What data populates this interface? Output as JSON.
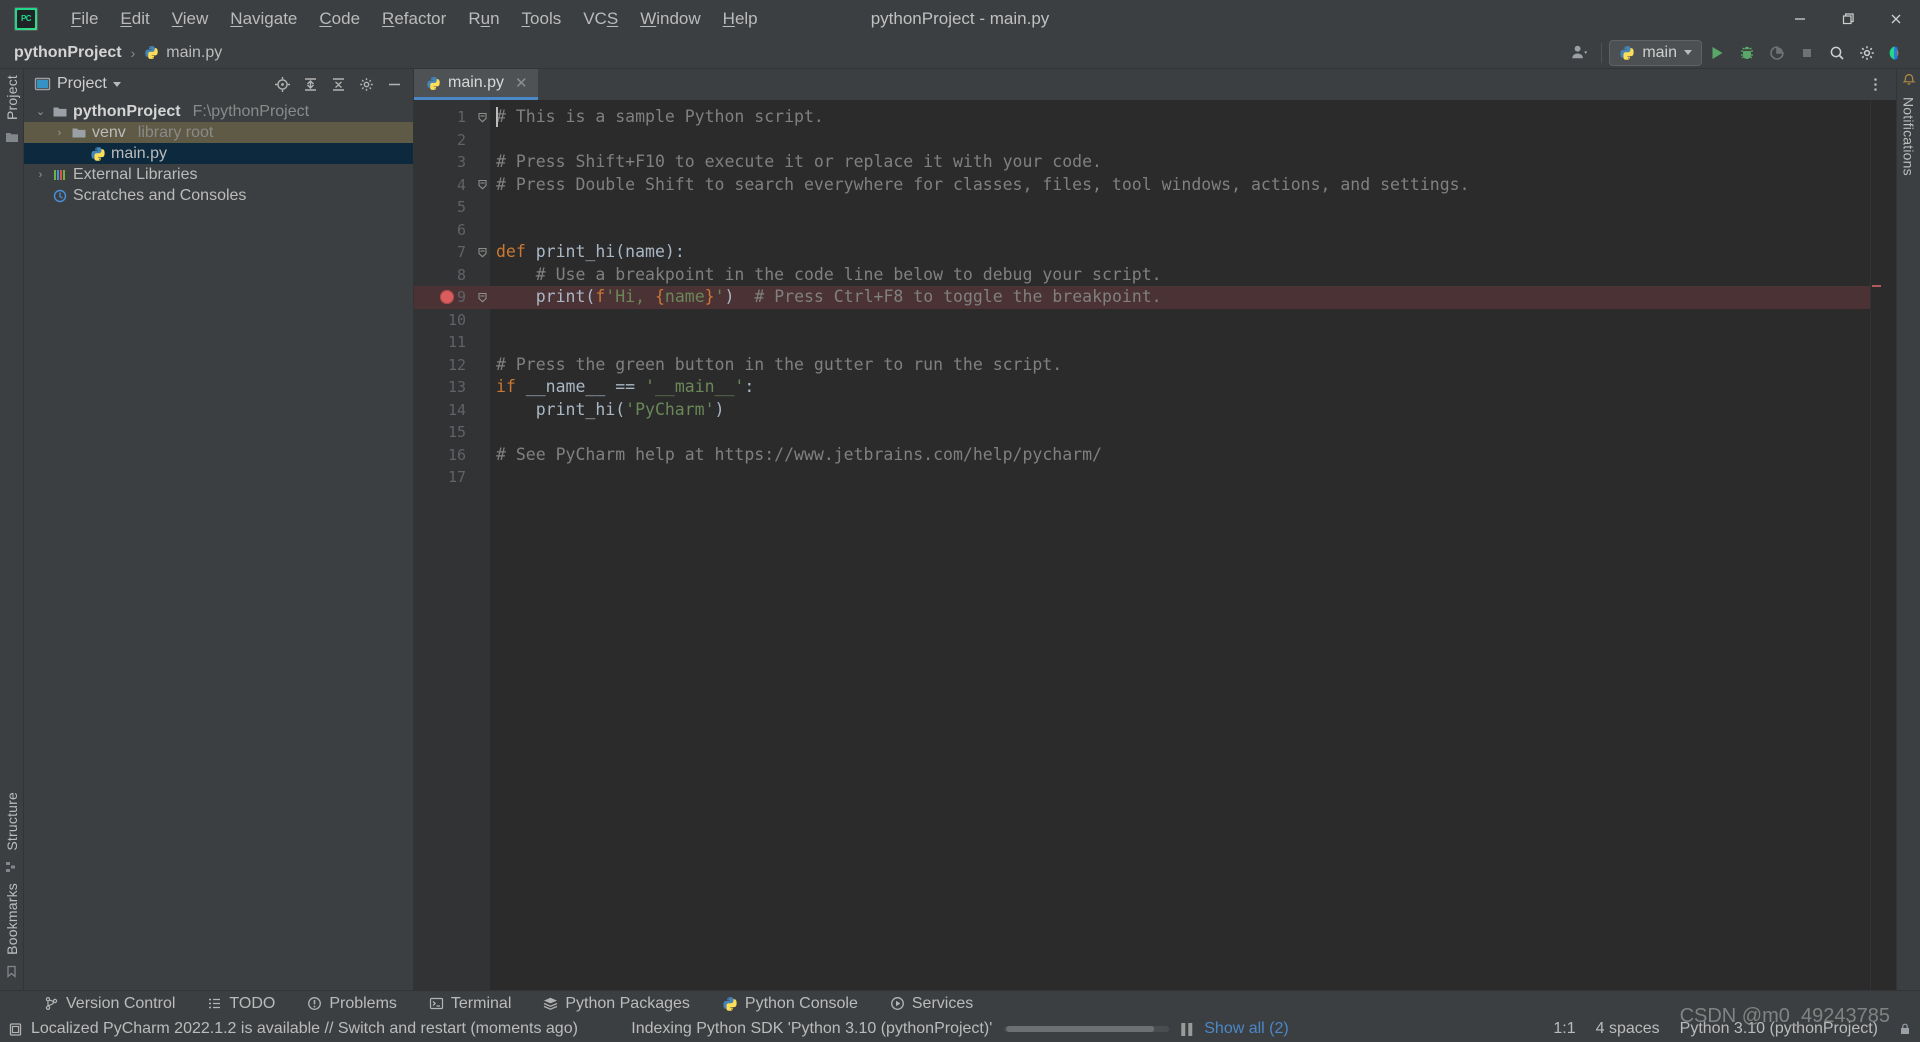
{
  "window": {
    "title": "pythonProject - main.py",
    "minimize_label": "—",
    "maximize_label": "❐",
    "close_label": "✕"
  },
  "menu": {
    "items": [
      {
        "label": "File",
        "mnemonic": "F"
      },
      {
        "label": "Edit",
        "mnemonic": "E"
      },
      {
        "label": "View",
        "mnemonic": "V"
      },
      {
        "label": "Navigate",
        "mnemonic": "N"
      },
      {
        "label": "Code",
        "mnemonic": "C"
      },
      {
        "label": "Refactor",
        "mnemonic": "R"
      },
      {
        "label": "Run",
        "mnemonic": "u"
      },
      {
        "label": "Tools",
        "mnemonic": "T"
      },
      {
        "label": "VCS",
        "mnemonic": "S"
      },
      {
        "label": "Window",
        "mnemonic": "W"
      },
      {
        "label": "Help",
        "mnemonic": "H"
      }
    ],
    "logo_text": "PC"
  },
  "breadcrumb": {
    "project": "pythonProject",
    "separator": "›",
    "file": "main.py"
  },
  "toolbar": {
    "run_config": "main",
    "icons": [
      "user-avatar-icon",
      "run-icon",
      "debug-icon",
      "profile-icon",
      "stop-icon",
      "search-everywhere-icon",
      "settings-icon",
      "jetbrains-ai-icon"
    ]
  },
  "left_stripe": {
    "top_label": "Project",
    "bottom_labels": [
      "Structure",
      "Bookmarks"
    ]
  },
  "right_stripe": {
    "label": "Notifications"
  },
  "project_panel": {
    "title": "Project",
    "header_icons": [
      "locate-icon",
      "expand-all-icon",
      "collapse-all-icon",
      "settings-icon",
      "hide-icon"
    ],
    "tree": [
      {
        "label": "pythonProject",
        "detail": "F:\\pythonProject",
        "icon": "folder-icon",
        "arrow": "⌄",
        "indent": 0,
        "state": "expanded",
        "bold": true,
        "highlight": "none"
      },
      {
        "label": "venv",
        "detail": "library root",
        "icon": "folder-icon",
        "arrow": "›",
        "indent": 1,
        "state": "collapsed",
        "bold": false,
        "highlight": "context"
      },
      {
        "label": "main.py",
        "detail": "",
        "icon": "python-file-icon",
        "arrow": "",
        "indent": 2,
        "state": "leaf",
        "bold": false,
        "highlight": "selected"
      },
      {
        "label": "External Libraries",
        "detail": "",
        "icon": "library-icon",
        "arrow": "›",
        "indent": 0,
        "state": "collapsed",
        "bold": false,
        "highlight": "none"
      },
      {
        "label": "Scratches and Consoles",
        "detail": "",
        "icon": "scratch-icon",
        "arrow": "",
        "indent": 0,
        "state": "leaf",
        "bold": false,
        "highlight": "none"
      }
    ]
  },
  "editor": {
    "tab": {
      "label": "main.py",
      "icon": "python-file-icon",
      "close": "✕"
    },
    "total_lines": 17,
    "breakpoint_line": 9,
    "highlight_line": 9,
    "caret_line": 1,
    "fold_lines": [
      1,
      4,
      7,
      9
    ],
    "lines": [
      {
        "n": 1,
        "tokens": [
          {
            "t": "# This is a sample Python script.",
            "c": "cmt"
          }
        ]
      },
      {
        "n": 2,
        "tokens": []
      },
      {
        "n": 3,
        "tokens": [
          {
            "t": "# Press Shift+F10 to execute it or replace it with your code.",
            "c": "cmt"
          }
        ]
      },
      {
        "n": 4,
        "tokens": [
          {
            "t": "# Press Double Shift to search everywhere for classes, files, tool windows, actions, and settings.",
            "c": "cmt"
          }
        ]
      },
      {
        "n": 5,
        "tokens": []
      },
      {
        "n": 6,
        "tokens": []
      },
      {
        "n": 7,
        "tokens": [
          {
            "t": "def ",
            "c": "kw"
          },
          {
            "t": "print_hi(name):",
            "c": "fn"
          }
        ]
      },
      {
        "n": 8,
        "tokens": [
          {
            "t": "    # Use a breakpoint in the code line below to debug your script.",
            "c": "cmt"
          }
        ]
      },
      {
        "n": 9,
        "tokens": [
          {
            "t": "    print(",
            "c": "ident"
          },
          {
            "t": "f",
            "c": "kw"
          },
          {
            "t": "'Hi, ",
            "c": "str"
          },
          {
            "t": "{",
            "c": "brace"
          },
          {
            "t": "name",
            "c": "str"
          },
          {
            "t": "}",
            "c": "brace"
          },
          {
            "t": "'",
            "c": "str"
          },
          {
            "t": ")  ",
            "c": "ident"
          },
          {
            "t": "# Press Ctrl+F8 to toggle the breakpoint.",
            "c": "cmt"
          }
        ]
      },
      {
        "n": 10,
        "tokens": []
      },
      {
        "n": 11,
        "tokens": []
      },
      {
        "n": 12,
        "tokens": [
          {
            "t": "# Press the green button in the gutter to run the script.",
            "c": "cmt"
          }
        ]
      },
      {
        "n": 13,
        "tokens": [
          {
            "t": "if ",
            "c": "kw"
          },
          {
            "t": "__name__ == ",
            "c": "ident"
          },
          {
            "t": "'__main__'",
            "c": "str"
          },
          {
            "t": ":",
            "c": "ident"
          }
        ]
      },
      {
        "n": 14,
        "tokens": [
          {
            "t": "    print_hi(",
            "c": "ident"
          },
          {
            "t": "'PyCharm'",
            "c": "str"
          },
          {
            "t": ")",
            "c": "ident"
          }
        ]
      },
      {
        "n": 15,
        "tokens": []
      },
      {
        "n": 16,
        "tokens": [
          {
            "t": "# See PyCharm help at https://www.jetbrains.com/help/pycharm/",
            "c": "cmt"
          }
        ]
      },
      {
        "n": 17,
        "tokens": []
      }
    ]
  },
  "tool_windows": [
    {
      "label": "Version Control",
      "icon": "branch-icon"
    },
    {
      "label": "TODO",
      "icon": "todo-list-icon"
    },
    {
      "label": "Problems",
      "icon": "warning-icon"
    },
    {
      "label": "Terminal",
      "icon": "terminal-icon"
    },
    {
      "label": "Python Packages",
      "icon": "packages-icon"
    },
    {
      "label": "Python Console",
      "icon": "python-icon"
    },
    {
      "label": "Services",
      "icon": "services-icon"
    }
  ],
  "status_bar": {
    "message": "Localized PyCharm 2022.1.2 is available // Switch and restart (moments ago)",
    "message_icon": "notification-icon",
    "indexing_text": "Indexing Python SDK 'Python 3.10 (pythonProject)'",
    "progress_percent": 92,
    "pause_icon": "pause-icon",
    "show_all": "Show all (2)",
    "caret_position": "1:1",
    "indent": "4 spaces",
    "interpreter": "Python 3.10 (pythonProject)",
    "lock_icon": "lock-icon"
  },
  "watermark": "CSDN @m0_49243785",
  "colors": {
    "accent_blue": "#4a88c7",
    "selection": "#0d293e",
    "context_row": "#5f5a45",
    "breakpoint": "#db5c5c",
    "breakpoint_line_bg": "#4b3234",
    "keyword": "#cc7832",
    "string": "#6a8759",
    "comment": "#808080",
    "default_text": "#a9b7c6",
    "editor_bg": "#2b2b2b",
    "chrome_bg": "#3c3f41",
    "gutter_bg": "#313335",
    "run_green": "#59a869"
  }
}
